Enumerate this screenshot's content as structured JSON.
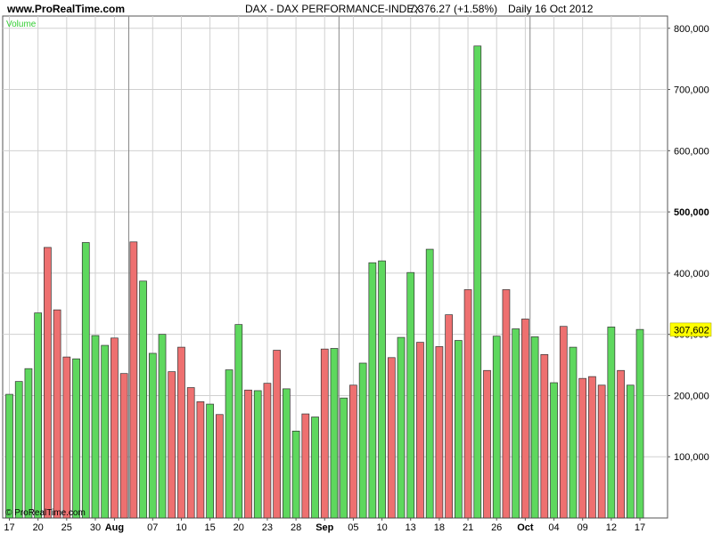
{
  "header": {
    "site": "www.ProRealTime.com",
    "title": "DAX - DAX PERFORMANCE-INDEX",
    "quote": "7,376.27 (+1.58%)",
    "period": "Daily  16 Oct 2012"
  },
  "copyright": "© ProRealTime.com",
  "colors": {
    "up": "#5ed85e",
    "down": "#ee7070",
    "last_value_bg": "#ffff00",
    "series_label": "#33cc33"
  },
  "chart_data": {
    "type": "bar",
    "series_label": "Volume",
    "ylim": [
      0,
      820000
    ],
    "y_ticks": [
      100000,
      200000,
      300000,
      400000,
      500000,
      600000,
      700000,
      800000
    ],
    "y_tick_labels": [
      "100,000",
      "200,000",
      "300,000",
      "400,000",
      "500,000",
      "600,000",
      "700,000",
      "800,000"
    ],
    "bold_ticks": [
      500000
    ],
    "last_value": 307602,
    "last_value_label": "307,602",
    "x_tick_labels": [
      {
        "bar": 1,
        "label": "17",
        "bold": false
      },
      {
        "bar": 4,
        "label": "20",
        "bold": false
      },
      {
        "bar": 7,
        "label": "25",
        "bold": false
      },
      {
        "bar": 10,
        "label": "30",
        "bold": false
      },
      {
        "bar": 12,
        "label": "Aug",
        "bold": true
      },
      {
        "bar": 16,
        "label": "07",
        "bold": false
      },
      {
        "bar": 19,
        "label": "10",
        "bold": false
      },
      {
        "bar": 22,
        "label": "15",
        "bold": false
      },
      {
        "bar": 25,
        "label": "20",
        "bold": false
      },
      {
        "bar": 28,
        "label": "23",
        "bold": false
      },
      {
        "bar": 31,
        "label": "28",
        "bold": false
      },
      {
        "bar": 34,
        "label": "Sep",
        "bold": true
      },
      {
        "bar": 37,
        "label": "05",
        "bold": false
      },
      {
        "bar": 40,
        "label": "10",
        "bold": false
      },
      {
        "bar": 43,
        "label": "13",
        "bold": false
      },
      {
        "bar": 46,
        "label": "18",
        "bold": false
      },
      {
        "bar": 49,
        "label": "21",
        "bold": false
      },
      {
        "bar": 52,
        "label": "26",
        "bold": false
      },
      {
        "bar": 55,
        "label": "Oct",
        "bold": true
      },
      {
        "bar": 58,
        "label": "04",
        "bold": false
      },
      {
        "bar": 61,
        "label": "09",
        "bold": false
      },
      {
        "bar": 64,
        "label": "12",
        "bold": false
      },
      {
        "bar": 67,
        "label": "17",
        "bold": false
      }
    ],
    "month_separators": [
      12.5,
      34.5,
      54.5
    ],
    "bars": [
      {
        "v": 202000,
        "d": "up"
      },
      {
        "v": 223000,
        "d": "up"
      },
      {
        "v": 244000,
        "d": "up"
      },
      {
        "v": 335000,
        "d": "up"
      },
      {
        "v": 442000,
        "d": "down"
      },
      {
        "v": 340000,
        "d": "down"
      },
      {
        "v": 263000,
        "d": "down"
      },
      {
        "v": 260000,
        "d": "up"
      },
      {
        "v": 450000,
        "d": "up"
      },
      {
        "v": 298000,
        "d": "up"
      },
      {
        "v": 282000,
        "d": "up"
      },
      {
        "v": 294000,
        "d": "down"
      },
      {
        "v": 236000,
        "d": "down"
      },
      {
        "v": 451000,
        "d": "down"
      },
      {
        "v": 387000,
        "d": "up"
      },
      {
        "v": 269000,
        "d": "up"
      },
      {
        "v": 300000,
        "d": "up"
      },
      {
        "v": 239000,
        "d": "down"
      },
      {
        "v": 279000,
        "d": "down"
      },
      {
        "v": 213000,
        "d": "down"
      },
      {
        "v": 190000,
        "d": "down"
      },
      {
        "v": 186000,
        "d": "up"
      },
      {
        "v": 169000,
        "d": "down"
      },
      {
        "v": 242000,
        "d": "up"
      },
      {
        "v": 316000,
        "d": "up"
      },
      {
        "v": 209000,
        "d": "down"
      },
      {
        "v": 208000,
        "d": "up"
      },
      {
        "v": 220000,
        "d": "down"
      },
      {
        "v": 274000,
        "d": "down"
      },
      {
        "v": 211000,
        "d": "up"
      },
      {
        "v": 142000,
        "d": "up"
      },
      {
        "v": 170000,
        "d": "down"
      },
      {
        "v": 165000,
        "d": "up"
      },
      {
        "v": 276000,
        "d": "down"
      },
      {
        "v": 277000,
        "d": "up"
      },
      {
        "v": 196000,
        "d": "up"
      },
      {
        "v": 217000,
        "d": "down"
      },
      {
        "v": 253000,
        "d": "up"
      },
      {
        "v": 417000,
        "d": "up"
      },
      {
        "v": 420000,
        "d": "up"
      },
      {
        "v": 262000,
        "d": "down"
      },
      {
        "v": 295000,
        "d": "up"
      },
      {
        "v": 401000,
        "d": "up"
      },
      {
        "v": 287000,
        "d": "down"
      },
      {
        "v": 439000,
        "d": "up"
      },
      {
        "v": 280000,
        "d": "down"
      },
      {
        "v": 332000,
        "d": "down"
      },
      {
        "v": 290000,
        "d": "up"
      },
      {
        "v": 373000,
        "d": "down"
      },
      {
        "v": 771000,
        "d": "up"
      },
      {
        "v": 241000,
        "d": "down"
      },
      {
        "v": 297000,
        "d": "up"
      },
      {
        "v": 373000,
        "d": "down"
      },
      {
        "v": 309000,
        "d": "up"
      },
      {
        "v": 325000,
        "d": "down"
      },
      {
        "v": 296000,
        "d": "up"
      },
      {
        "v": 267000,
        "d": "down"
      },
      {
        "v": 221000,
        "d": "up"
      },
      {
        "v": 313000,
        "d": "down"
      },
      {
        "v": 279000,
        "d": "up"
      },
      {
        "v": 228000,
        "d": "down"
      },
      {
        "v": 231000,
        "d": "down"
      },
      {
        "v": 217000,
        "d": "down"
      },
      {
        "v": 312000,
        "d": "up"
      },
      {
        "v": 241000,
        "d": "down"
      },
      {
        "v": 217000,
        "d": "up"
      },
      {
        "v": 308000,
        "d": "up"
      }
    ]
  }
}
